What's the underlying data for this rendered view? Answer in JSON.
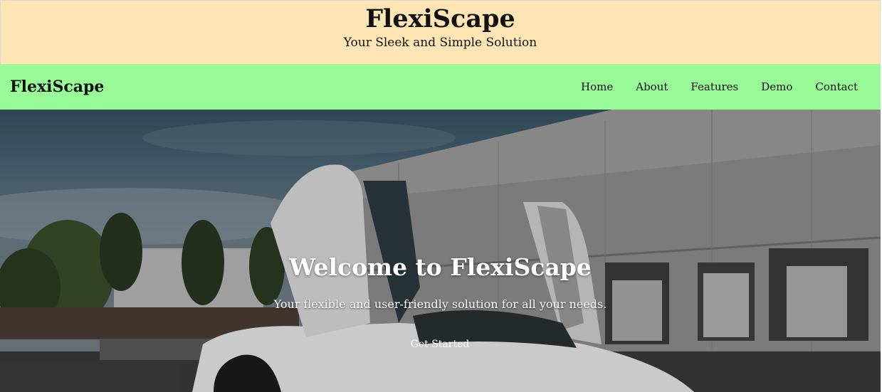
{
  "banner": {
    "title": "FlexiScape",
    "tagline": "Your Sleek and Simple Solution"
  },
  "navbar": {
    "brand": "FlexiScape",
    "links": [
      "Home",
      "About",
      "Features",
      "Demo",
      "Contact"
    ]
  },
  "hero": {
    "title": "Welcome to FlexiScape",
    "subtitle": "Your flexible and user-friendly solution for all your needs.",
    "cta_label": "Get Started",
    "image_subject": "white sports car with open butterfly doors in front of warehouse"
  },
  "colors": {
    "banner_bg": "#ffe5b4",
    "navbar_bg": "#98fb98",
    "hero_text": "#ffffff"
  }
}
